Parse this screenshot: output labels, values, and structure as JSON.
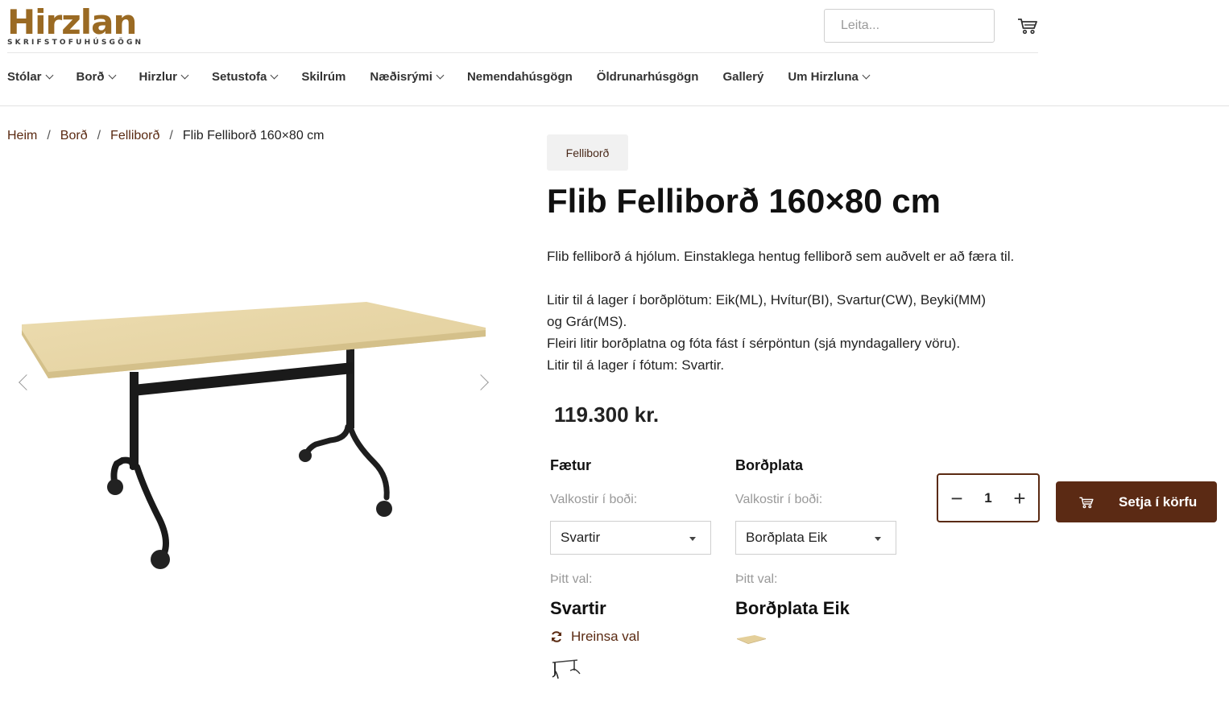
{
  "brand": {
    "name": "Hirzlan",
    "tagline": "SKRIFSTOFUHÚSGÖGN"
  },
  "search": {
    "placeholder": "Leita..."
  },
  "nav": [
    {
      "label": "Stólar",
      "dropdown": true
    },
    {
      "label": "Borð",
      "dropdown": true
    },
    {
      "label": "Hirzlur",
      "dropdown": true
    },
    {
      "label": "Setustofa",
      "dropdown": true
    },
    {
      "label": "Skilrúm",
      "dropdown": false
    },
    {
      "label": "Næðisrými",
      "dropdown": true
    },
    {
      "label": "Nemendahúsgögn",
      "dropdown": false
    },
    {
      "label": "Öldrunarhúsgögn",
      "dropdown": false
    },
    {
      "label": "Gallerý",
      "dropdown": false
    },
    {
      "label": "Um Hirzluna",
      "dropdown": true
    }
  ],
  "breadcrumb": {
    "items": [
      "Heim",
      "Borð",
      "Felliborð"
    ],
    "current": "Flib Felliborð 160×80 cm",
    "separator": "/"
  },
  "product": {
    "tag": "Felliborð",
    "title": "Flib Felliborð 160×80 cm",
    "description": {
      "intro": "Flib felliborð á hjólum. Einstaklega hentug felliborð sem auðvelt er að færa til.",
      "colors_line1": "Litir til á lager í borðplötum: Eik(ML), Hvítur(BI), Svartur(CW), Beyki(MM)",
      "colors_line2": "og Grár(MS).",
      "more_colors": "Fleiri litir borðplatna og fóta fást í sérpöntun (sjá myndagallery vöru).",
      "legs_colors": "Litir til á lager í fótum: Svartir."
    },
    "price": "119.300 kr."
  },
  "options": {
    "legs": {
      "title": "Fætur",
      "available_label": "Valkostir í boði:",
      "selected": "Svartir",
      "choice_label": "Þitt val:",
      "choice_value": "Svartir",
      "reset_label": "Hreinsa val"
    },
    "top": {
      "title": "Borðplata",
      "available_label": "Valkostir í boði:",
      "selected": "Borðplata Eik",
      "choice_label": "Þitt val:",
      "choice_value": "Borðplata Eik"
    }
  },
  "cart": {
    "quantity": "1",
    "minus": "−",
    "plus": "+",
    "add_label": "Setja í körfu"
  },
  "colors": {
    "brand_brown": "#5b2a14",
    "logo_gold": "#9a6a23",
    "oak": "#e8d7a8"
  }
}
